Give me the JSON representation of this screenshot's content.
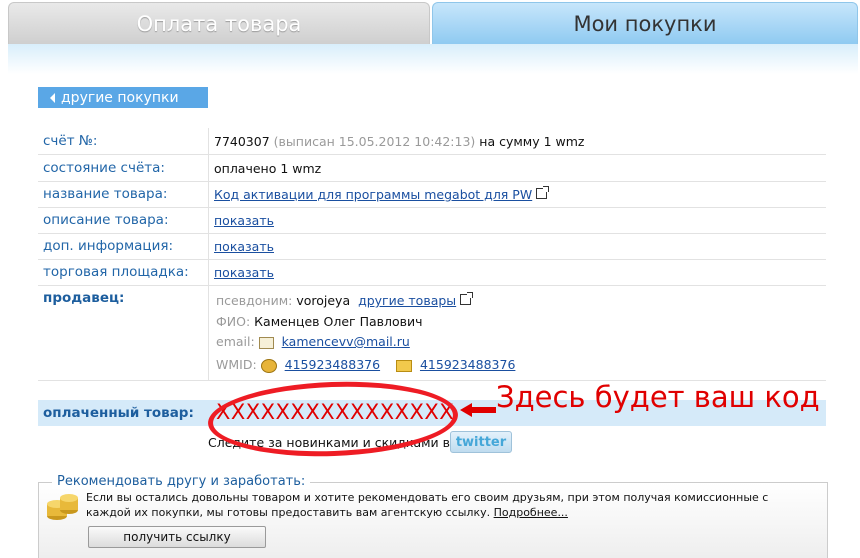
{
  "tabs": [
    {
      "label": "Оплата товара",
      "active": false
    },
    {
      "label": "Мои покупки",
      "active": true
    }
  ],
  "back_link": "другие покупки",
  "invoice": {
    "number_label": "счёт №:",
    "number": "7740307",
    "issued": "(выписан 15.05.2012 10:42:13)",
    "sum_text": "на сумму 1 wmz",
    "status_label": "состояние счёта:",
    "status": "оплачено 1 wmz",
    "product_label": "название товара:",
    "product_name": "Код активации для программы megabot для PW",
    "description_label": "описание товара:",
    "description_link": "показать",
    "extra_label": "доп. информация:",
    "extra_link": "показать",
    "marketplace_label": "торговая площадка:",
    "marketplace_link": "показать"
  },
  "seller": {
    "label": "продавец:",
    "alias_label": "псевдоним:",
    "alias": "vorojeya",
    "other_goods": "другие товары",
    "fio_label": "ФИО:",
    "fio": "Каменцев Олег Павлович",
    "email_label": "email:",
    "email": "kamencevv@mail.ru",
    "wmid_label": "WMID:",
    "wmid": "415923488376",
    "wmid2": "415923488376"
  },
  "paid": {
    "label": "оплаченный товар:",
    "code": "XXXXXXXXXXXXXXXX",
    "follow_text": "Следите за новинками и скидками в",
    "twitter": "twitter"
  },
  "annotation": {
    "text": "Здесь будет ваш код",
    "color": "#e00000"
  },
  "recommend": {
    "title": "Рекомендовать другу и заработать:",
    "text": "Если вы остались довольны товаром и хотите рекомендовать его своим друзьям, при этом получая комиссионные с каждой их покупки, мы готовы предоставить вам агентскую ссылку.",
    "more": "Подробнее...",
    "button": "получить ссылку"
  }
}
